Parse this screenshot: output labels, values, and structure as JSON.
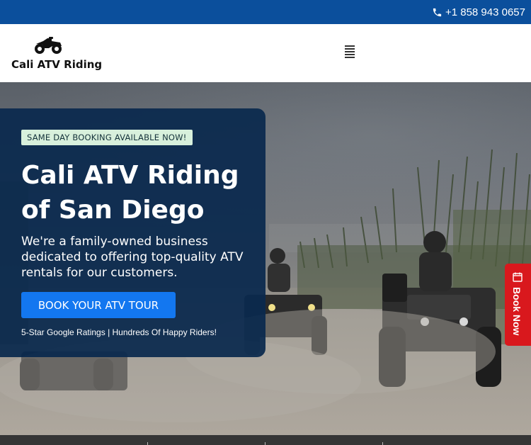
{
  "topbar": {
    "phone": "+1 858 943 0657",
    "phone_icon": "phone-icon",
    "background": "#0b4f9c"
  },
  "brand": {
    "name": "Cali ATV Riding",
    "logo_icon": "atv-icon"
  },
  "nav": {
    "menu_icon": "hamburger-menu-icon"
  },
  "hero": {
    "badge": "SAME DAY BOOKING AVAILABLE NOW!",
    "headline_line1": "Cali ATV Riding",
    "headline_line2": "of San Diego",
    "description": "We're a family-owned business dedicated to offering top-quality ATV rentals for our customers.",
    "cta_label": "BOOK YOUR ATV TOUR",
    "ratings": "5-Star Google Ratings | Hundreds Of Happy Riders!",
    "card_color": "#0a294e",
    "cta_color": "#1377f0"
  },
  "book_now": {
    "label": "Book Now",
    "icon": "calendar-icon",
    "color": "#d9181d"
  }
}
